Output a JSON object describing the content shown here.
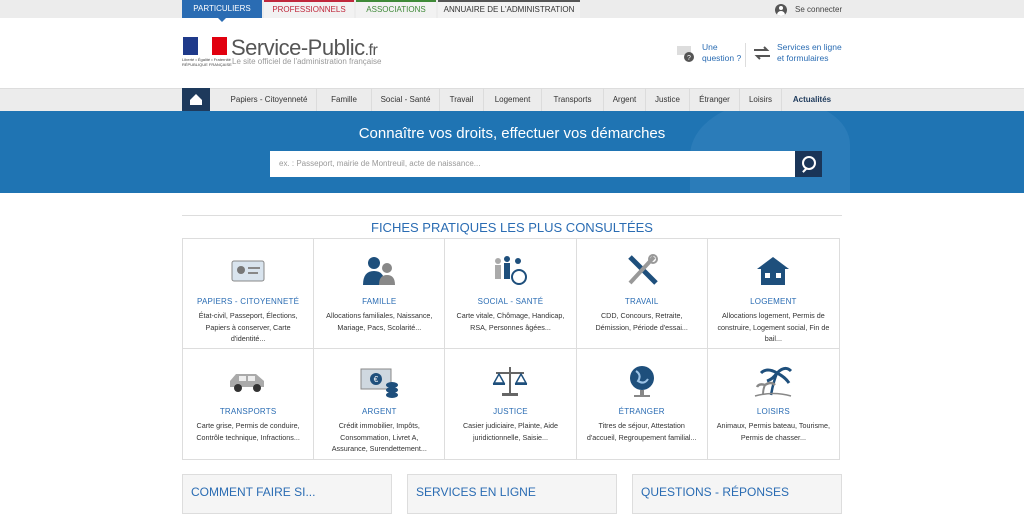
{
  "audience_tabs": [
    "PARTICULIERS",
    "PROFESSIONNELS",
    "ASSOCIATIONS",
    "ANNUAIRE DE L'ADMINISTRATION"
  ],
  "header": {
    "connect_label": "Se connecter",
    "logo_mini_text": "Liberté • Égalité • Fraternité RÉPUBLIQUE FRANÇAISE",
    "logo_name": "Service-Public",
    "logo_tld": ".fr",
    "logo_subtitle": "Le site officiel de l'administration française",
    "question_label": "Une question ?",
    "services_label": "Services en ligne et formulaires"
  },
  "nav": {
    "items": [
      "Papiers - Citoyenneté",
      "Famille",
      "Social - Santé",
      "Travail",
      "Logement",
      "Transports",
      "Argent",
      "Justice",
      "Étranger",
      "Loisirs",
      "Actualités"
    ]
  },
  "hero": {
    "title": "Connaître vos droits, effectuer vos démarches",
    "search_placeholder": "ex. : Passeport, mairie de Montreuil, acte de naissance..."
  },
  "fiches": {
    "title": "FICHES PRATIQUES LES PLUS CONSULTÉES",
    "cards": [
      {
        "title": "PAPIERS - CITOYENNETÉ",
        "desc": "État-civil, Passeport, Élections, Papiers à conserver, Carte d'identité...",
        "icon": "id-card-icon"
      },
      {
        "title": "FAMILLE",
        "desc": "Allocations familiales, Naissance, Mariage, Pacs, Scolarité...",
        "icon": "family-icon"
      },
      {
        "title": "SOCIAL - SANTÉ",
        "desc": "Carte vitale, Chômage, Handicap, RSA, Personnes âgées...",
        "icon": "social-icon"
      },
      {
        "title": "TRAVAIL",
        "desc": "CDD, Concours, Retraite, Démission, Période d'essai...",
        "icon": "tools-icon"
      },
      {
        "title": "LOGEMENT",
        "desc": "Allocations logement, Permis de construire, Logement social, Fin de bail...",
        "icon": "house-icon"
      },
      {
        "title": "TRANSPORTS",
        "desc": "Carte grise, Permis de conduire, Contrôle technique, Infractions...",
        "icon": "car-icon"
      },
      {
        "title": "ARGENT",
        "desc": "Crédit immobilier, Impôts, Consommation, Livret A, Assurance, Surendettement...",
        "icon": "money-icon"
      },
      {
        "title": "JUSTICE",
        "desc": "Casier judiciaire, Plainte, Aide juridictionnelle, Saisie...",
        "icon": "scales-icon"
      },
      {
        "title": "ÉTRANGER",
        "desc": "Titres de séjour, Attestation d'accueil, Regroupement familial...",
        "icon": "globe-icon"
      },
      {
        "title": "LOISIRS",
        "desc": "Animaux, Permis bateau, Tourisme, Permis de chasser...",
        "icon": "palm-icon"
      }
    ]
  },
  "bottom": [
    "COMMENT FAIRE SI...",
    "SERVICES EN LIGNE",
    "QUESTIONS - RÉPONSES"
  ],
  "colors": {
    "primary": "#2a6cb3",
    "hero": "#1f74b3",
    "dark": "#1e3a5c"
  }
}
